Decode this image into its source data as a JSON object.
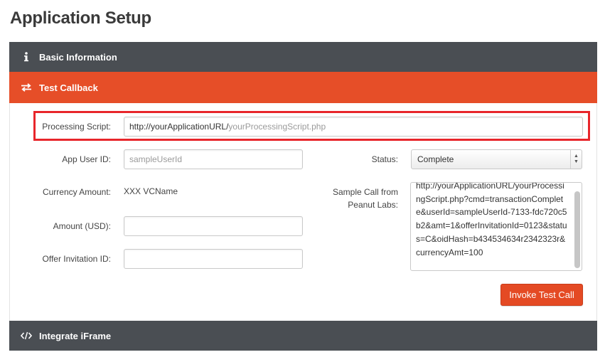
{
  "page": {
    "title": "Application Setup"
  },
  "sections": {
    "basic": {
      "label": "Basic Information",
      "icon": "info-icon"
    },
    "test": {
      "label": "Test Callback",
      "icon": "swap-arrows-icon"
    },
    "iframe": {
      "label": "Integrate iFrame",
      "icon": "code-icon"
    }
  },
  "form": {
    "processing_script": {
      "label": "Processing Script:",
      "value_prefix": "http://yourApplicationURL/",
      "placeholder_suffix": "yourProcessingScript.php"
    },
    "app_user_id": {
      "label": "App User ID:",
      "placeholder": "sampleUserId"
    },
    "currency_amount": {
      "label": "Currency Amount:",
      "value": "XXX VCName"
    },
    "amount_usd": {
      "label": "Amount (USD):",
      "value": ""
    },
    "offer_invitation_id": {
      "label": "Offer Invitation ID:",
      "value": ""
    },
    "status": {
      "label": "Status:",
      "selected": "Complete"
    },
    "sample_call": {
      "label_line1": "Sample Call from",
      "label_line2": "Peanut Labs:",
      "value": "http://yourApplicationURL/yourProcessingScript.php?cmd=transactionComplete&userId=sampleUserId-7133-fdc720c5b2&amt=1&offerInvitationId=0123&status=C&oidHash=b434534634r2342323r&currencyAmt=100"
    },
    "invoke_button": "Invoke Test Call"
  },
  "colors": {
    "header_dark": "#4a4e53",
    "accent_orange": "#e64e28",
    "highlight_red": "#e8262b"
  }
}
